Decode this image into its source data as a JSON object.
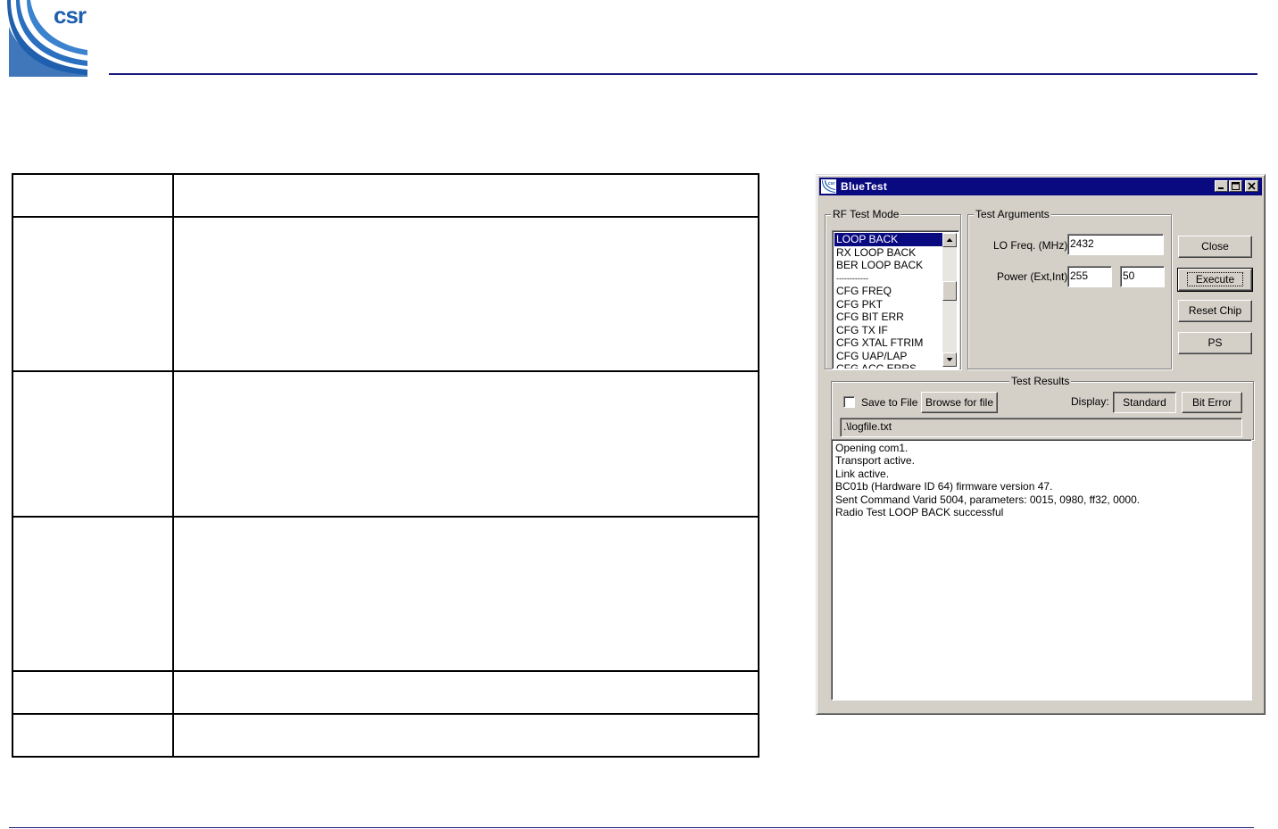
{
  "brand": {
    "logo_text": "csr",
    "logo_color": "#1f5fae",
    "rule_color": "#1a1a7a"
  },
  "doc_table": {
    "rows": 6
  },
  "dialog": {
    "title": "BlueTest",
    "title_icon": "csr-app-icon",
    "controls": [
      "minimize-icon",
      "maximize-icon",
      "close-icon"
    ],
    "rf_test_mode": {
      "label": "RF Test Mode",
      "items": [
        "LOOP BACK",
        "RX LOOP BACK",
        "BER LOOP BACK",
        "------------",
        "CFG FREQ",
        "CFG PKT",
        "CFG BIT ERR",
        "CFG TX IF",
        "CFG XTAL FTRIM",
        "CFG UAP/LAP",
        "CFG ACC ERRS"
      ],
      "selected": "LOOP BACK"
    },
    "test_arguments": {
      "label": "Test Arguments",
      "lo_freq_label": "LO Freq. (MHz)",
      "lo_freq_value": "2432",
      "power_label": "Power (Ext,Int)",
      "power_ext_value": "255",
      "power_int_value": "50"
    },
    "buttons": {
      "close": "Close",
      "execute": "Execute",
      "reset_chip": "Reset Chip",
      "ps": "PS"
    },
    "test_results": {
      "label": "Test Results",
      "save_to_file_label": "Save to File",
      "save_to_file_checked": false,
      "browse_label": "Browse for file",
      "display_label": "Display:",
      "display_standard": "Standard",
      "display_bit_error": "Bit Error",
      "log_path": ".\\logfile.txt",
      "log_lines": [
        "Opening com1.",
        "Transport active.",
        "Link active.",
        "BC01b (Hardware ID 64) firmware version 47.",
        "Sent Command Varid 5004, parameters: 0015, 0980, ff32, 0000.",
        "Radio Test LOOP BACK successful"
      ]
    },
    "colors": {
      "face": "#d4d0c8",
      "titlebar": "#0a0a80",
      "selection": "#0a0a80"
    }
  }
}
